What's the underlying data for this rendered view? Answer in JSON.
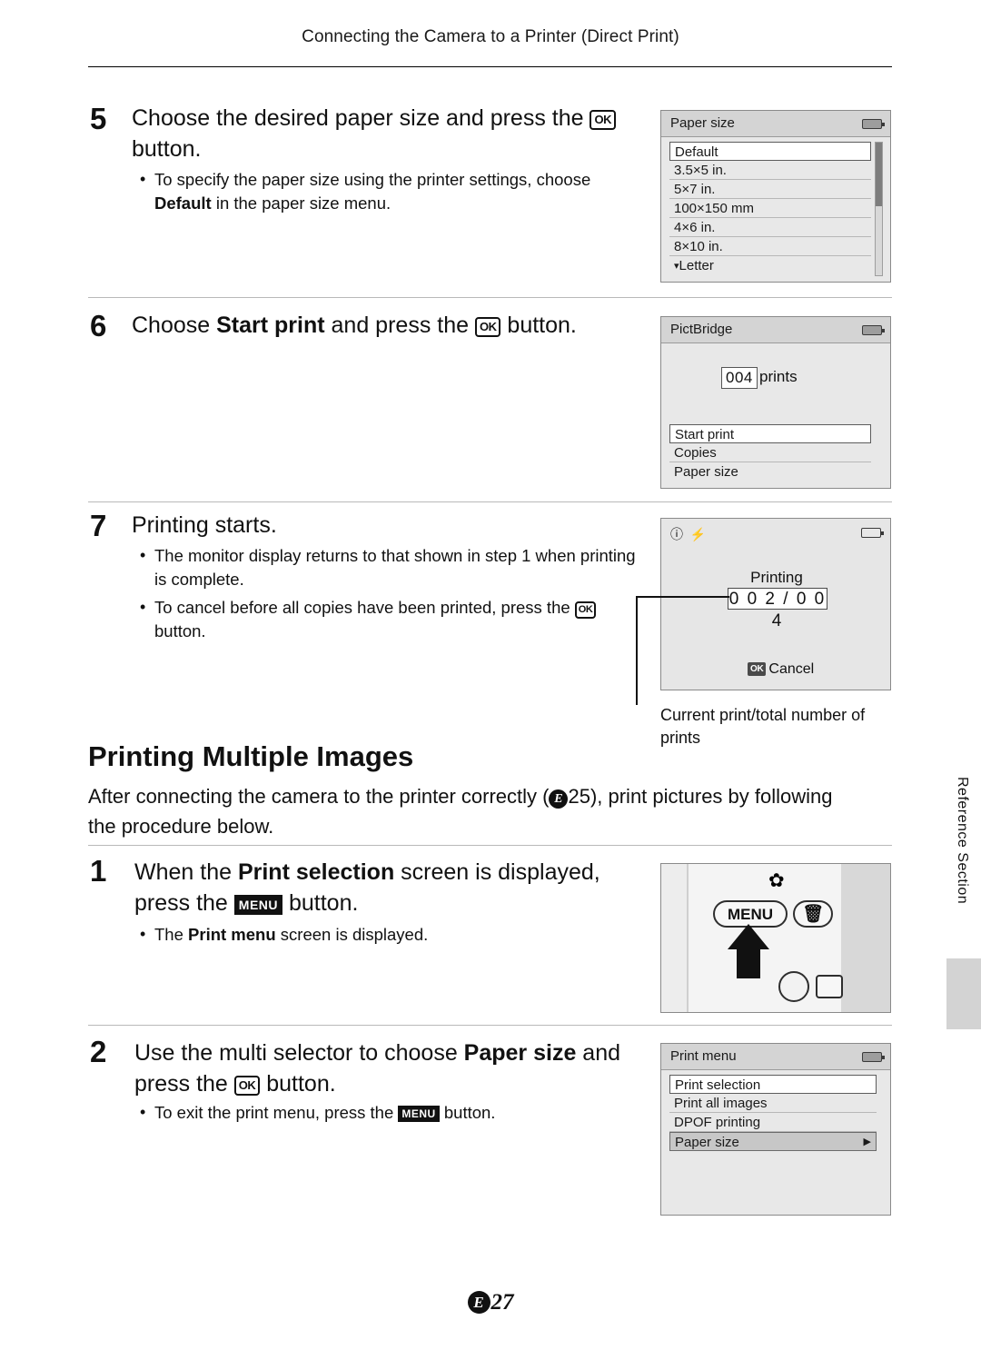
{
  "header": {
    "title": "Connecting the Camera to a Printer (Direct Print)"
  },
  "steps": [
    {
      "num": "5",
      "title_pre": "Choose the desired paper size and press the ",
      "title_post": " button.",
      "bullets": [
        {
          "pre": "To specify the paper size using the printer settings, choose ",
          "bold": "Default",
          "post": " in the paper size menu."
        }
      ]
    },
    {
      "num": "6",
      "title_pre": "Choose ",
      "title_bold": "Start print",
      "title_mid": " and press the ",
      "title_post": " button."
    },
    {
      "num": "7",
      "title": "Printing starts.",
      "bullets": [
        {
          "text": "The monitor display returns to that shown in step 1 when printing is complete."
        },
        {
          "pre": "To cancel before all copies have been printed, press the ",
          "post": " button."
        }
      ]
    }
  ],
  "paper_size_screen": {
    "title": "Paper size",
    "items": [
      "Default",
      "3.5×5 in.",
      "5×7 in.",
      "100×150 mm",
      "4×6 in.",
      "8×10 in.",
      "Letter"
    ],
    "selected": "Default",
    "last_item_prefix": "↵"
  },
  "pictbridge_screen": {
    "title": "PictBridge",
    "count": "004",
    "count_label": "prints",
    "items": [
      "Start print",
      "Copies",
      "Paper size"
    ],
    "selected": "Start print"
  },
  "printing_screen": {
    "label": "Printing",
    "progress": "0 0 2 / 0 0 4",
    "cancel_label": "Cancel",
    "cancel_button": "OK"
  },
  "printing_caption": "Current print/total number of prints",
  "section": {
    "heading": "Printing Multiple Images",
    "intro_pre": "After connecting the camera to the printer correctly (",
    "intro_ref": "25",
    "intro_post": "), print pictures by following the procedure below."
  },
  "multi_steps": [
    {
      "num": "1",
      "title_pre": "When the ",
      "title_bold": "Print selection",
      "title_mid": " screen is displayed, press the ",
      "title_post": " button.",
      "bullet_pre": "The ",
      "bullet_bold": "Print menu",
      "bullet_post": " screen is displayed."
    },
    {
      "num": "2",
      "title_pre": "Use the multi selector to choose ",
      "title_bold": "Paper size",
      "title_mid": " and press the ",
      "title_post": " button.",
      "bullet_pre": "To exit the print menu, press the ",
      "bullet_post": " button."
    }
  ],
  "camera_photo": {
    "menu_label": "MENU",
    "trash_icon": "trash-icon",
    "macro_icon": "macro-flower-icon"
  },
  "print_menu_screen": {
    "title": "Print menu",
    "items": [
      "Print selection",
      "Print all images",
      "DPOF printing",
      "Paper size"
    ],
    "selected": "Paper size"
  },
  "side_tab": {
    "label": "Reference Section"
  },
  "page_number": {
    "prefix": "E",
    "value": "27"
  },
  "glyphs": {
    "ok": "OK",
    "menu": "MENU"
  }
}
